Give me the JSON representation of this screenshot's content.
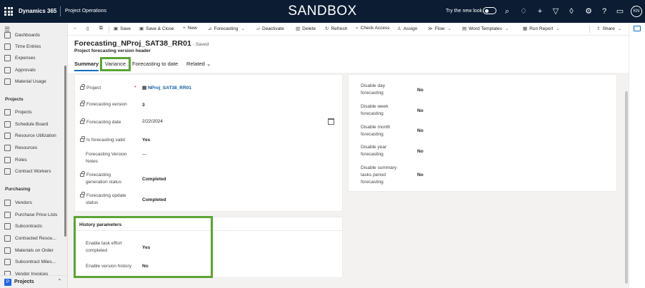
{
  "topbar": {
    "app_name": "Dynamics 365",
    "area_name": "Project Operations",
    "environment": "SANDBOX",
    "try_new_look": "Try the new look",
    "avatar_initials": "KN"
  },
  "sidebar": {
    "items": [
      {
        "label": "Dashboards",
        "icon": "dashboard-icon"
      },
      {
        "label": "Time Entries",
        "icon": "clock-icon"
      },
      {
        "label": "Expenses",
        "icon": "receipt-icon"
      },
      {
        "label": "Approvals",
        "icon": "approval-icon"
      },
      {
        "label": "Material Usage",
        "icon": "material-icon"
      }
    ],
    "projects_header": "Projects",
    "project_items": [
      {
        "label": "Projects",
        "icon": "projects-icon"
      },
      {
        "label": "Schedule Board",
        "icon": "calendar-icon"
      },
      {
        "label": "Resource Utilization",
        "icon": "chart-icon"
      },
      {
        "label": "Resources",
        "icon": "resource-icon"
      },
      {
        "label": "Roles",
        "icon": "role-icon"
      },
      {
        "label": "Contract Workers",
        "icon": "worker-icon"
      }
    ],
    "purchasing_header": "Purchasing",
    "purchasing_items": [
      {
        "label": "Vendors",
        "icon": "vendor-icon"
      },
      {
        "label": "Purchase Price Lists",
        "icon": "pricelist-icon"
      },
      {
        "label": "Subcontracts",
        "icon": "document-icon"
      },
      {
        "label": "Contracted Resou...",
        "icon": "contract-icon"
      },
      {
        "label": "Materials on Order",
        "icon": "box-icon"
      },
      {
        "label": "Subcontract Miles...",
        "icon": "milestone-icon"
      },
      {
        "label": "Vendor Invoices",
        "icon": "invoice-icon"
      }
    ],
    "footer": {
      "badge": "P",
      "label": "Projects"
    }
  },
  "commandbar": {
    "back": "←",
    "save": "Save",
    "save_close": "Save & Close",
    "new": "New",
    "forecasting": "Forecasting",
    "deactivate": "Deactivate",
    "delete": "Delete",
    "refresh": "Refresh",
    "check_access": "Check Access",
    "assign": "Assign",
    "flow": "Flow",
    "word_templates": "Word Templates",
    "run_report": "Run Report",
    "share": "Share"
  },
  "header": {
    "title": "Forecasting_NProj_SAT38_RR01",
    "saved": "- Saved",
    "subtitle": "Project forecasting version header",
    "tabs": {
      "summary": "Summary",
      "variance": "Variance",
      "forecasting_to_date": "Forecasting to date",
      "related": "Related"
    }
  },
  "general": {
    "project_label": "Project",
    "project_value": "NProj_SAT38_RR01",
    "version_label": "Forecasting version",
    "version_value": "3",
    "date_label": "Forecasting date",
    "date_value": "2/22/2024",
    "valid_label": "Is forecasting valid",
    "valid_value": "Yes",
    "notes_label_1": "Forecasting Version",
    "notes_label_2": "Notes",
    "notes_value": "---",
    "gen_status_label_1": "Forecasting",
    "gen_status_label_2": "generation status",
    "gen_status_value": "Completed",
    "upd_status_label_1": "Forecasting update",
    "upd_status_label_2": "status",
    "upd_status_value": "Completed"
  },
  "disable_settings": {
    "day_label_1": "Disable day",
    "day_label_2": "forecasting",
    "day_value": "No",
    "week_label_1": "Disable week",
    "week_label_2": "forecasting",
    "week_value": "No",
    "month_label_1": "Disable month",
    "month_label_2": "forecasting",
    "month_value": "No",
    "year_label_1": "Disable year",
    "year_label_2": "forecasting",
    "year_value": "No",
    "summary_label_1": "Disable summary",
    "summary_label_2": "tasks period",
    "summary_label_3": "forecasting",
    "summary_value": "No"
  },
  "history": {
    "title": "History parameters",
    "task_effort_label_1": "Enable task effort",
    "task_effort_label_2": "completed",
    "task_effort_value": "Yes",
    "version_history_label": "Enable version history",
    "version_history_value": "No"
  },
  "colors": {
    "topbar": "#0b1c33",
    "highlight": "#5aa532",
    "link": "#115ea3",
    "tab_underline": "#0f6cbd"
  }
}
